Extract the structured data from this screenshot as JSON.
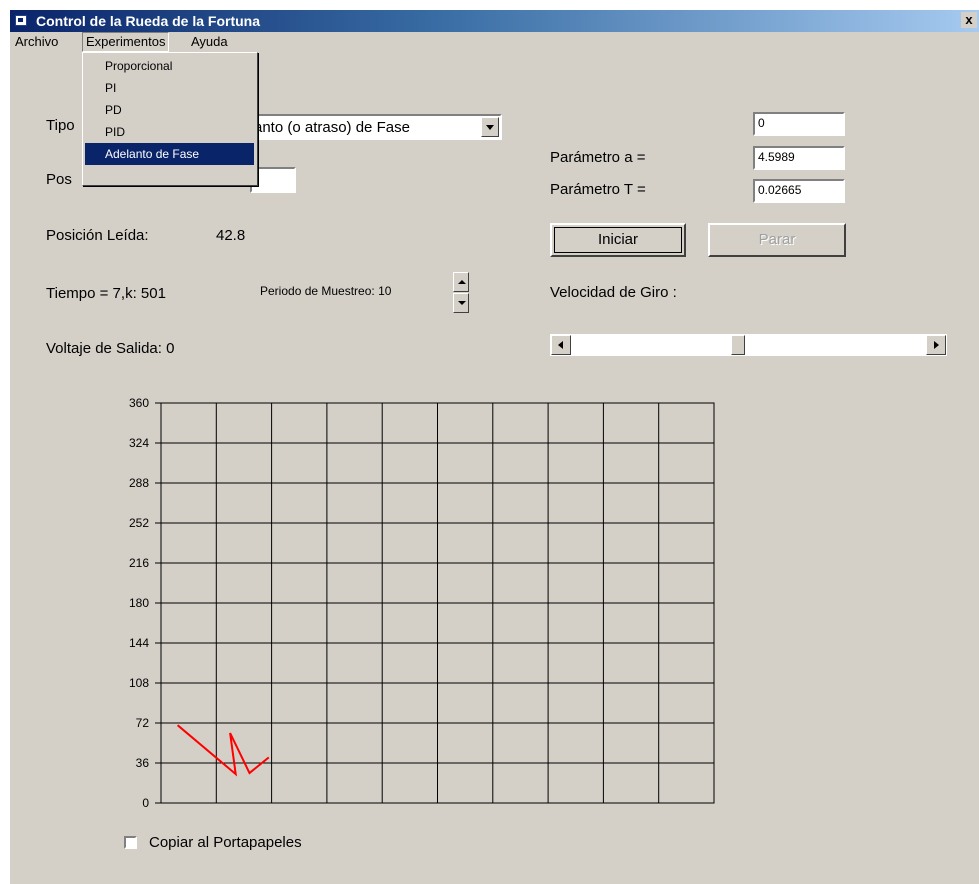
{
  "window": {
    "title": "Control de la Rueda de la Fortuna",
    "close_label": "x"
  },
  "menubar": {
    "items": [
      "Archivo",
      "Experimentos",
      "Ayuda"
    ],
    "open_menu": "Experimentos"
  },
  "experimentos_menu": {
    "items": [
      "Proporcional",
      "PI",
      "PD",
      "PID",
      "Adelanto de Fase"
    ],
    "selected": "Adelanto de Fase"
  },
  "form": {
    "tipo_label_visible": "Tipo",
    "controller_combo_value": "anto (o atraso) de Fase",
    "pos_label_visible": "Pos",
    "posicion_leida_label": "Posición Leída:",
    "posicion_leida_value": "42.8",
    "tiempo_text": "Tiempo = 7,k: 501",
    "periodo_text": "Periodo de Muestreo: 10",
    "voltaje_text": "Voltaje de Salida: 0",
    "param_top_value": "0",
    "param_a_label": "Parámetro a =",
    "param_a_value": "4.5989",
    "param_t_label": "Parámetro T =",
    "param_t_value": "0.02665",
    "iniciar_label": "Iniciar",
    "parar_label": "Parar",
    "velocidad_label": "Velocidad de Giro :",
    "velocidad_fraction": 0.47,
    "copiar_label": "Copiar al Portapapeles",
    "copiar_checked": false
  },
  "chart_data": {
    "type": "line",
    "y_ticks": [
      "360",
      "324",
      "288",
      "252",
      "216",
      "180",
      "144",
      "108",
      "72",
      "36",
      "0"
    ],
    "ylim": [
      0,
      360
    ],
    "x_divisions": 10,
    "grid": true,
    "series": [
      {
        "color": "#ff0000",
        "x": [
          0.3,
          1.35,
          1.25,
          1.6,
          1.95
        ],
        "y": [
          70,
          26,
          63,
          27,
          41
        ]
      }
    ]
  }
}
